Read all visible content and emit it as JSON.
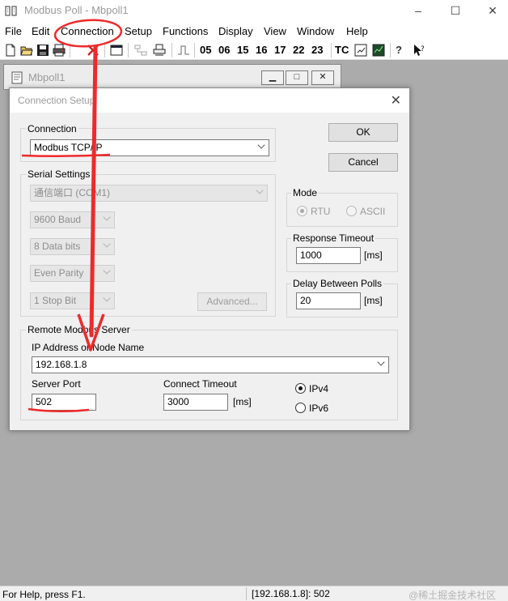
{
  "app": {
    "title": "Modbus Poll - Mbpoll1",
    "window_controls": [
      "–",
      "☐",
      "✕"
    ]
  },
  "menu": {
    "items": [
      "File",
      "Edit",
      "Connection",
      "Setup",
      "Functions",
      "Display",
      "View",
      "Window",
      "Help"
    ]
  },
  "toolbar": {
    "function_codes": [
      "05",
      "06",
      "15",
      "16",
      "17",
      "22",
      "23"
    ],
    "tc_label": "TC",
    "icons": [
      "new-file-icon",
      "open-folder-icon",
      "save-icon",
      "print-icon",
      "disconnect-icon",
      "window-icon",
      "network-icon",
      "printer-list-icon",
      "pulse-icon",
      "traffic-icon",
      "chart-icon",
      "help-icon",
      "context-help-icon"
    ]
  },
  "child_window": {
    "title": "Mbpoll1",
    "controls": [
      "▁",
      "□",
      "✕"
    ]
  },
  "dialog": {
    "title": "Connection Setup",
    "close": "✕",
    "connection": {
      "label": "Connection",
      "value": "Modbus TCP/IP"
    },
    "serial": {
      "label": "Serial Settings",
      "port": "通信端口 (COM1)",
      "baud": "9600 Baud",
      "data_bits": "8 Data bits",
      "parity": "Even Parity",
      "stop_bits": "1 Stop Bit",
      "advanced": "Advanced..."
    },
    "ok": "OK",
    "cancel": "Cancel",
    "mode": {
      "label": "Mode",
      "rtu": "RTU",
      "ascii": "ASCII"
    },
    "response_timeout": {
      "label": "Response Timeout",
      "value": "1000",
      "unit": "[ms]"
    },
    "delay_polls": {
      "label": "Delay Between Polls",
      "value": "20",
      "unit": "[ms]"
    },
    "remote": {
      "label": "Remote Modbus Server",
      "ip_label": "IP Address or Node Name",
      "ip_value": "192.168.1.8",
      "port_label": "Server Port",
      "port_value": "502",
      "timeout_label": "Connect Timeout",
      "timeout_value": "3000",
      "timeout_unit": "[ms]",
      "ipv4": "IPv4",
      "ipv6": "IPv6"
    }
  },
  "status": {
    "help": "For Help, press F1.",
    "connection": "[192.168.1.8]: 502",
    "watermark": "@稀土掘金技术社区"
  },
  "colors": {
    "annotation_red": "#ee2a2a",
    "mdi_background": "#ababab",
    "dialog_background": "#f0f0f0"
  }
}
